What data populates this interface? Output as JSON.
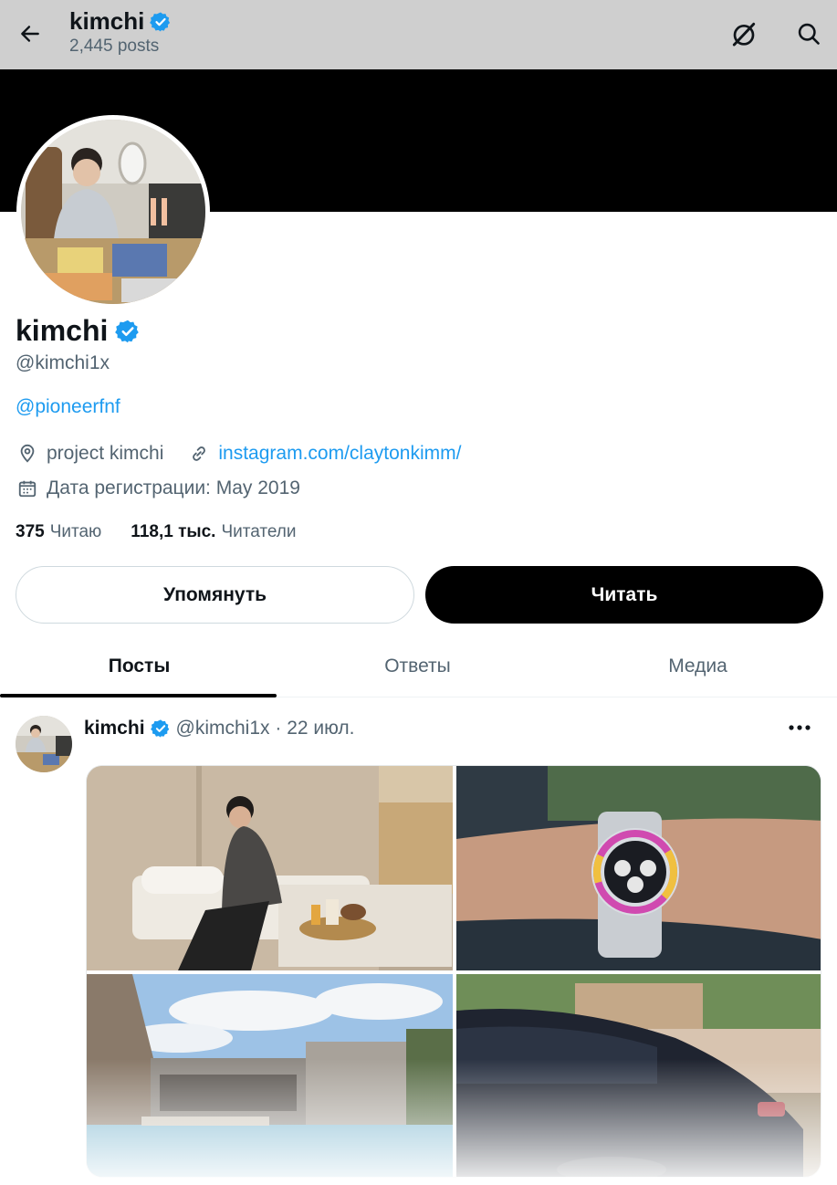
{
  "header": {
    "title": "kimchi",
    "posts_count": "2,445 posts"
  },
  "profile": {
    "name": "kimchi",
    "handle": "@kimchi1x",
    "bio_mention": "@pioneerfnf",
    "location": "project kimchi",
    "website": "instagram.com/claytonkimm/",
    "joined": "Дата регистрации: May 2019",
    "following_count": "375",
    "following_label": "Читаю",
    "followers_count": "118,1 тыс.",
    "followers_label": "Читатели"
  },
  "actions": {
    "mention_label": "Упомянуть",
    "follow_label": "Читать"
  },
  "tabs": [
    {
      "label": "Посты"
    },
    {
      "label": "Ответы"
    },
    {
      "label": "Медиа"
    }
  ],
  "post": {
    "name": "kimchi",
    "meta": "@kimchi1x · 22 июл."
  },
  "colors": {
    "accent": "#1d9bf0",
    "verified": "#1d9bf0",
    "topbar": "#cfcfcf"
  }
}
